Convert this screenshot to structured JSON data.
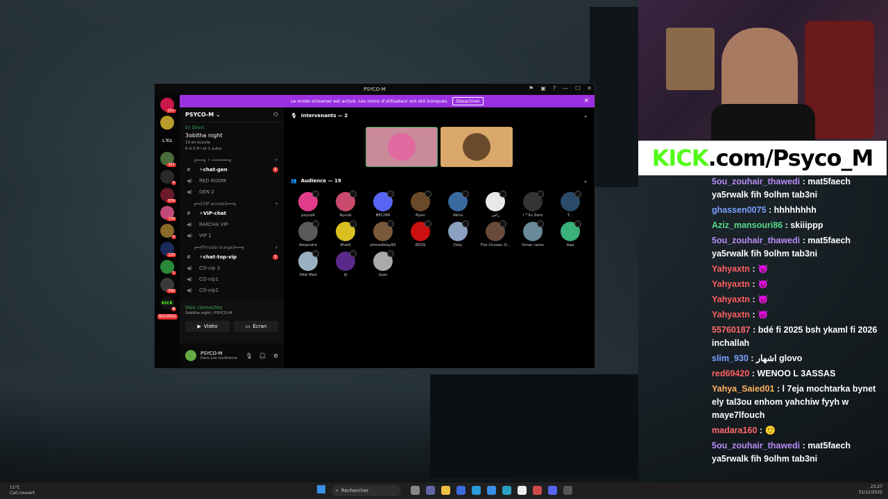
{
  "discord": {
    "window_title": "PSYCO-M",
    "banner": {
      "text": "Le mode streamer est activé. Les noms d'utilisateur ont été tronqués.",
      "button": "Désactiver"
    },
    "server_name": "PSYCO-M",
    "live_tag": "En Direct",
    "stage_name": "3obitha night",
    "listening": "19 en écoute",
    "listeners_sub": "R A S H I et 1 autre",
    "categories": [
      "╔═══╗ ⚡ ═══════╗",
      "╔══[VIP access]═══╗",
      "╔══[Private lounge]═══╗"
    ],
    "channels": [
      {
        "name": "✧chat-gen",
        "badge": "1"
      },
      {
        "name": "RED ROOM"
      },
      {
        "name": "GEN 2"
      },
      {
        "name": "✧VIP-chat"
      },
      {
        "name": "RAKCHA VIP"
      },
      {
        "name": "VIP 1"
      },
      {
        "name": "✧chat-top-vip",
        "badge": "1"
      },
      {
        "name": "CO-vip 3"
      },
      {
        "name": "CO-vip1"
      },
      {
        "name": "CO-vip2"
      }
    ],
    "voice": {
      "status": "Voix connectée",
      "channel": "3obitha night / PSYCO-M"
    },
    "video_label": "Vidéo",
    "screen_label": "Écran",
    "user": {
      "name": "PSYCO-M",
      "status": "Dans une conférence"
    },
    "speakers_header": "Intervenants — 2",
    "audience_header": "Audience — 19",
    "server_letters": [
      "L'Ks"
    ],
    "server_new": "NOUVEAU",
    "server_badges": [
      "10+",
      "347",
      "4",
      "609",
      "108",
      "4",
      "126",
      "5",
      "598",
      "4"
    ],
    "audience": [
      {
        "name": "psyco4",
        "color": "#e03c8a"
      },
      {
        "name": "Ayoub",
        "color": "#c94a6c"
      },
      {
        "name": "BECHIR",
        "color": "#5865f2"
      },
      {
        "name": "Ryan",
        "color": "#6b4a2a"
      },
      {
        "name": "Akira",
        "color": "#3a6aa0"
      },
      {
        "name": "رامي",
        "color": "#e8e8e8"
      },
      {
        "name": "!™Its Zero",
        "color": "#333333"
      },
      {
        "name": "T...",
        "color": "#2a4a6a"
      },
      {
        "name": "Alejandro",
        "color": "#5a5a5a"
      },
      {
        "name": "Khalil",
        "color": "#d9c020"
      },
      {
        "name": "ahmedklay95",
        "color": "#7a5a3a"
      },
      {
        "name": "KEOS",
        "color": "#cc1111"
      },
      {
        "name": "Daly",
        "color": "#8aa0c0"
      },
      {
        "name": "The Chosen O...",
        "color": "#6a4a3a"
      },
      {
        "name": "Omar ramo",
        "color": "#6a8a9a"
      },
      {
        "name": "Aaa",
        "color": "#3ab07a"
      },
      {
        "name": "3Alé Med",
        "color": "#9ab0c0"
      },
      {
        "name": "ïįï",
        "color": "#5a2a8a"
      },
      {
        "name": "ilyes",
        "color": "#aaaaaa"
      }
    ]
  },
  "kick_banner": {
    "prefix": "KICK",
    "suffix": ".com/Psyco_M"
  },
  "chat": [
    {
      "user": "5ou_zouhair_thawedi",
      "color": "#b98cf5",
      "text": "mat5faech ya5rwalk fih 9olhm tab3ni"
    },
    {
      "user": "ghassen0075",
      "color": "#7aa0ff",
      "text": "hhhhhhhh"
    },
    {
      "user": "Aziz_mansouri86",
      "color": "#55d98a",
      "text": "skiiippp"
    },
    {
      "user": "5ou_zouhair_thawedi",
      "color": "#b98cf5",
      "text": "mat5faech ya5rwalk fih 9olhm tab3ni"
    },
    {
      "user": "Yahyaxtn",
      "color": "#ff5f5f",
      "text": "😈"
    },
    {
      "user": "Yahyaxtn",
      "color": "#ff5f5f",
      "text": "😈"
    },
    {
      "user": "Yahyaxtn",
      "color": "#ff5f5f",
      "text": "😈"
    },
    {
      "user": "Yahyaxtn",
      "color": "#ff5f5f",
      "text": "😈"
    },
    {
      "user": "55760187",
      "color": "#ff6a6a",
      "text": "bdé fi 2025 bsh ykaml fi 2026 inchallah"
    },
    {
      "user": "slim_930",
      "color": "#7aa0ff",
      "text": "اشهار glovo"
    },
    {
      "user": "red69420",
      "color": "#ff5f5f",
      "text": "WENOO L 3ASSAS"
    },
    {
      "user": "Yahya_Saied01",
      "color": "#ffb35f",
      "text": "l 7eja mochtarka bynet ely tal3ou enhom yahchiw fyyh w maye7lfouch"
    },
    {
      "user": "madara160",
      "color": "#ff6a6a",
      "text": "🙂"
    },
    {
      "user": "5ou_zouhair_thawedi",
      "color": "#b98cf5",
      "text": "mat5faech ya5rwalk fih 9olhm tab3ni"
    }
  ],
  "taskbar": {
    "weather_temp": "11°C",
    "weather_desc": "Ciel couvert",
    "search": "Rechercher",
    "time": "23:27",
    "date": "31/12/2025"
  }
}
